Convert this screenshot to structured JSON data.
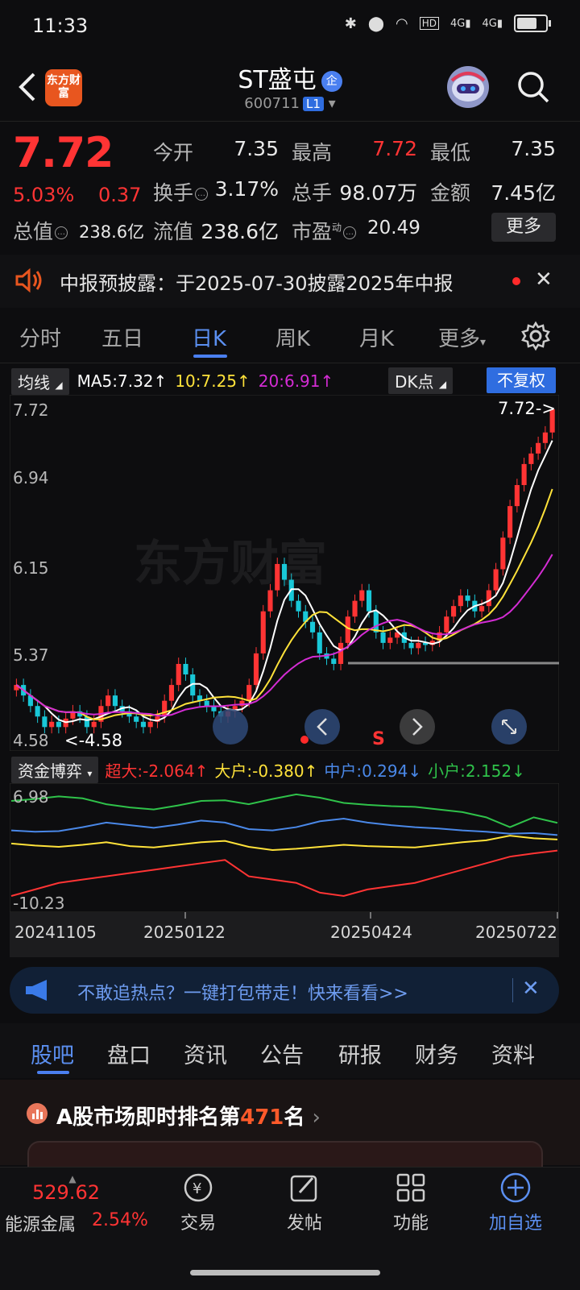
{
  "status": {
    "time": "11:33",
    "hd": "HD",
    "net1": "4G",
    "net2": "4G"
  },
  "header": {
    "logo_text": "东方财富",
    "stock_name": "ST盛屯",
    "badge": "企",
    "code": "600711",
    "level": "L1"
  },
  "quote": {
    "price": "7.72",
    "change_pct": "5.03%",
    "change_abs": "0.37",
    "open_label": "今开",
    "open": "7.35",
    "high_label": "最高",
    "high": "7.72",
    "low_label": "最低",
    "low": "7.35",
    "turnover_label": "换手",
    "turnover": "3.17%",
    "volume_label": "总手",
    "volume": "98.07万",
    "amount_label": "金额",
    "amount": "7.45亿",
    "mcap_label": "总值",
    "mcap": "238.6亿",
    "float_label": "流值",
    "float": "238.6亿",
    "pe_label": "市盈",
    "pe_super": "动",
    "pe": "20.49",
    "more": "更多"
  },
  "notice": {
    "text": "中报预披露：于2025-07-30披露2025年中报"
  },
  "periods": [
    "分时",
    "五日",
    "日K",
    "周K",
    "月K",
    "更多"
  ],
  "ma_bar": {
    "selector": "均线",
    "ma5": "MA5:7.32",
    "ma10": "10:7.25",
    "ma20": "20:6.91",
    "dk": "DK点",
    "fq": "不复权"
  },
  "colors": {
    "up": "#ff3434",
    "down": "#19c8d8",
    "ma5": "#ffffff",
    "ma10": "#ffe23a",
    "ma20": "#d42cd4",
    "accent": "#4a7ff0"
  },
  "chart_data": [
    {
      "type": "candlestick",
      "y_ticks": [
        "7.72",
        "6.94",
        "6.15",
        "5.37",
        "4.58"
      ],
      "ylim": [
        4.58,
        7.72
      ],
      "annotations": {
        "last": "7.72->",
        "low": "<-4.58",
        "signal": "S"
      },
      "x_ticks": [
        "20241105",
        "20250122",
        "20250424",
        "20250722"
      ],
      "close": [
        5.1,
        5.0,
        4.9,
        4.8,
        4.7,
        4.75,
        4.7,
        4.78,
        4.85,
        4.8,
        4.7,
        4.75,
        4.9,
        5.0,
        4.9,
        4.85,
        4.8,
        4.75,
        4.7,
        4.75,
        4.8,
        4.95,
        5.1,
        5.3,
        5.2,
        5.0,
        4.95,
        4.9,
        4.85,
        4.8,
        4.85,
        4.9,
        4.95,
        5.1,
        5.4,
        5.8,
        6.0,
        6.25,
        6.1,
        5.9,
        5.8,
        5.7,
        5.6,
        5.4,
        5.35,
        5.3,
        5.5,
        5.75,
        5.9,
        6.0,
        5.8,
        5.6,
        5.5,
        5.55,
        5.6,
        5.5,
        5.45,
        5.5,
        5.48,
        5.52,
        5.6,
        5.75,
        5.85,
        5.95,
        5.9,
        5.8,
        5.85,
        6.0,
        6.2,
        6.5,
        6.8,
        7.0,
        7.2,
        7.3,
        7.4,
        7.5,
        7.72
      ],
      "ma_values": {
        "MA5": "7.32",
        "MA10": "7.25",
        "MA20": "6.91"
      }
    },
    {
      "type": "line",
      "title": "资金博弈",
      "y_ticks": [
        "6.98",
        "-10.23"
      ],
      "ylim": [
        -10.23,
        6.98
      ],
      "series": [
        {
          "name": "超大:-2.064",
          "values": [
            -9,
            -8,
            -7,
            -6.5,
            -6,
            -5.5,
            -5,
            -4.5,
            -4,
            -3.5,
            -6,
            -6.5,
            -7,
            -8.5,
            -9,
            -8,
            -7.5,
            -7,
            -6,
            -5,
            -4,
            -3,
            -2.5,
            -2.064
          ]
        },
        {
          "name": "大户:-0.380",
          "values": [
            -1,
            -1.3,
            -1.5,
            -1.2,
            -0.8,
            -1.4,
            -1.6,
            -1.2,
            -0.8,
            -0.6,
            -1.5,
            -2,
            -1.8,
            -1.5,
            -1.2,
            -1.4,
            -1.5,
            -1.6,
            -1.2,
            -0.8,
            -0.5,
            0.2,
            -0.2,
            -0.38
          ]
        },
        {
          "name": "中户:0.294",
          "values": [
            1,
            0.8,
            0.9,
            1.5,
            2.2,
            1.8,
            1.4,
            1.9,
            2.5,
            2.2,
            1.2,
            1,
            1.5,
            2.4,
            2.8,
            2.2,
            1.8,
            1.5,
            1.3,
            1,
            0.8,
            0.5,
            0.6,
            0.294
          ]
        },
        {
          "name": "小户:2.152",
          "values": [
            5.5,
            5.8,
            6.2,
            5.9,
            5.0,
            4.5,
            4.2,
            4.8,
            5.5,
            5.6,
            5.0,
            5.8,
            6.5,
            6.0,
            5.2,
            4.9,
            4.7,
            4.6,
            4.2,
            3.8,
            3.0,
            1.5,
            3.0,
            2.152
          ]
        }
      ]
    }
  ],
  "ad": {
    "text": "不敢追热点？一键打包带走！快来看看>>"
  },
  "subtabs": [
    "股吧",
    "盘口",
    "资讯",
    "公告",
    "研报",
    "财务",
    "资料"
  ],
  "rank": {
    "prefix": "A股市场即时排名第",
    "num": "471",
    "suffix": "名"
  },
  "bottom": {
    "index_value": "529.62",
    "index_name": "能源金属",
    "index_pct": "2.54%",
    "trade": "交易",
    "post": "发帖",
    "func": "功能",
    "add": "加自选"
  }
}
